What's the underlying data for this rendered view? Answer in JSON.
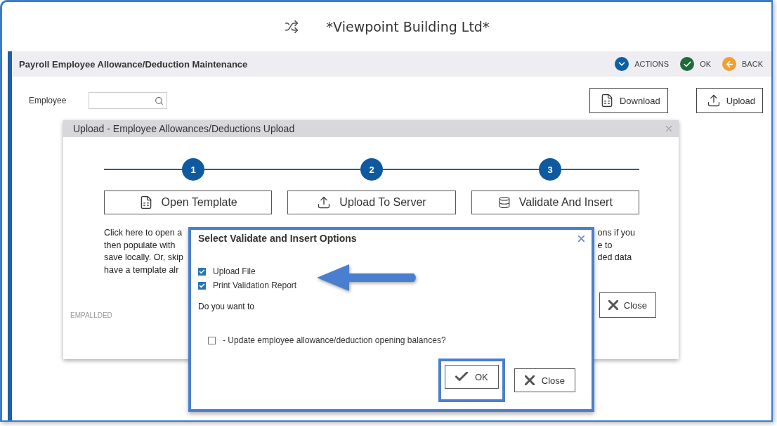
{
  "app_title": "*Viewpoint Building Ltd*",
  "page": {
    "title": "Payroll Employee Allowance/Deduction Maintenance",
    "actions": [
      {
        "label": "ACTIONS",
        "kind": "actions",
        "color": "#0b5fa5"
      },
      {
        "label": "OK",
        "kind": "ok",
        "color": "#1e6b3a"
      },
      {
        "label": "BACK",
        "kind": "back",
        "color": "#f0a030"
      }
    ]
  },
  "employee_field": {
    "label": "Employee"
  },
  "toolbar_buttons": [
    {
      "label": "Download",
      "kind": "xls"
    },
    {
      "label": "Upload",
      "kind": "upload"
    }
  ],
  "upload_dialog": {
    "title": "Upload - Employee Allowances/Deductions Upload",
    "steps": [
      "1",
      "2",
      "3"
    ],
    "step_buttons": [
      {
        "label": "Open Template",
        "kind": "xls"
      },
      {
        "label": "Upload To Server",
        "kind": "upload"
      },
      {
        "label": "Validate And Insert",
        "kind": "database"
      }
    ],
    "description_left": [
      "Click here to open a",
      "then populate with",
      "save locally. Or, skip",
      "have a template alr"
    ],
    "description_right": [
      "ons if you",
      "e to",
      "ded data"
    ],
    "close_button": "Close",
    "code": "EMPALLDED"
  },
  "options_dialog": {
    "title": "Select Validate and Insert Options",
    "options": [
      {
        "label": "Upload File",
        "checked": true
      },
      {
        "label": "Print Validation Report",
        "checked": true
      }
    ],
    "prompt": "Do you want to",
    "extra_options": [
      {
        "label": "- Update employee allowance/deduction opening balances?",
        "checked": false
      }
    ],
    "buttons": [
      {
        "label": "OK",
        "kind": "ok",
        "highlighted": true
      },
      {
        "label": "Close",
        "kind": "close",
        "highlighted": false
      }
    ]
  }
}
